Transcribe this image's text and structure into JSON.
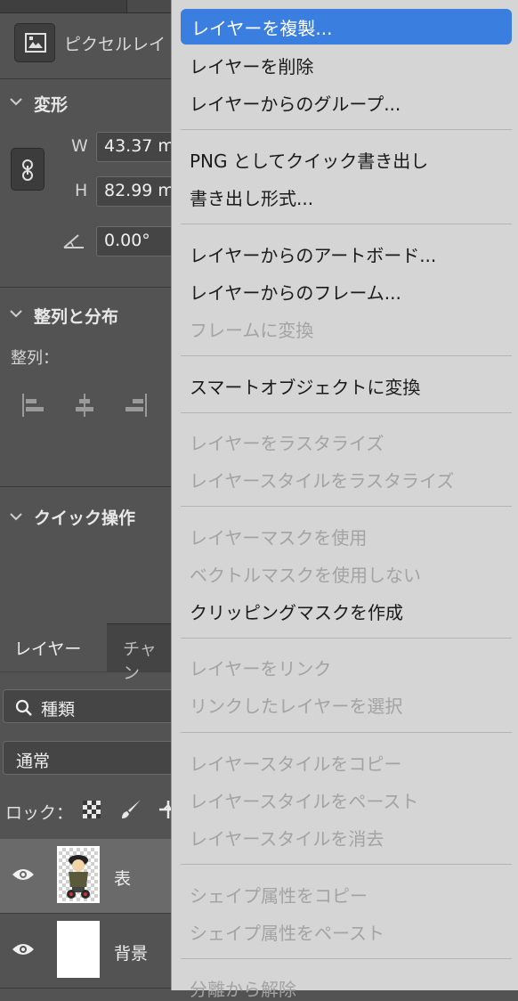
{
  "left_panel": {
    "layer_type_label": "ピクセルレイ",
    "transform": {
      "title": "変形",
      "w_label": "W",
      "w_value": "43.37 m",
      "h_label": "H",
      "h_value": "82.99 m",
      "angle_value": "0.00°"
    },
    "align": {
      "title": "整列と分布",
      "sub_label": "整列："
    },
    "quick_actions": {
      "title": "クイック操作"
    },
    "layers_panel": {
      "tab_layers": "レイヤー",
      "tab_channels": "チャン",
      "search_text": "種類",
      "blend_mode": "通常",
      "lock_label": "ロック："
    },
    "layers": [
      {
        "name": "表",
        "selected": true
      },
      {
        "name": "背景",
        "selected": false
      }
    ]
  },
  "context_menu": {
    "highlight_color": "#3a7ee0",
    "items": [
      {
        "label": "レイヤーを複製...",
        "enabled": true,
        "highlighted": true
      },
      {
        "label": "レイヤーを削除",
        "enabled": true
      },
      {
        "label": "レイヤーからのグループ...",
        "enabled": true
      },
      {
        "label": "PNG としてクイック書き出し",
        "enabled": true
      },
      {
        "label": "書き出し形式...",
        "enabled": true
      },
      {
        "label": "レイヤーからのアートボード...",
        "enabled": true
      },
      {
        "label": "レイヤーからのフレーム...",
        "enabled": true
      },
      {
        "label": "フレームに変換",
        "enabled": false
      },
      {
        "label": "スマートオブジェクトに変換",
        "enabled": true
      },
      {
        "label": "レイヤーをラスタライズ",
        "enabled": false
      },
      {
        "label": "レイヤースタイルをラスタライズ",
        "enabled": false
      },
      {
        "label": "レイヤーマスクを使用",
        "enabled": false
      },
      {
        "label": "ベクトルマスクを使用しない",
        "enabled": false
      },
      {
        "label": "クリッピングマスクを作成",
        "enabled": true
      },
      {
        "label": "レイヤーをリンク",
        "enabled": false
      },
      {
        "label": "リンクしたレイヤーを選択",
        "enabled": false
      },
      {
        "label": "レイヤースタイルをコピー",
        "enabled": false
      },
      {
        "label": "レイヤースタイルをペースト",
        "enabled": false
      },
      {
        "label": "レイヤースタイルを消去",
        "enabled": false
      },
      {
        "label": "シェイプ属性をコピー",
        "enabled": false
      },
      {
        "label": "シェイプ属性をペースト",
        "enabled": false
      },
      {
        "label": "分離から解除",
        "enabled": false
      }
    ]
  }
}
